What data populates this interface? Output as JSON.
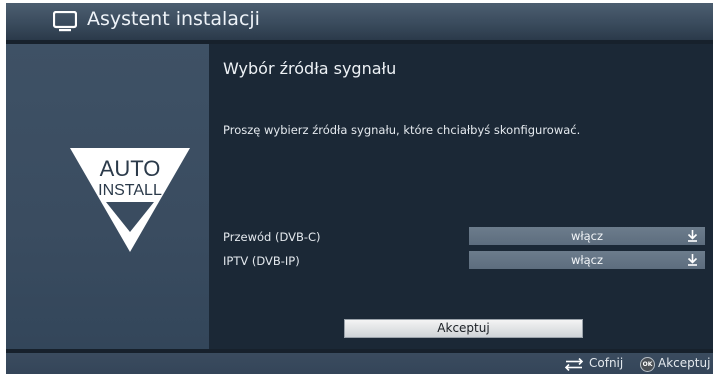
{
  "header": {
    "title": "Asystent instalacji",
    "icon": "tv-icon"
  },
  "logo": {
    "line1": "AUTO",
    "line2": "INSTALL"
  },
  "main": {
    "section_title": "Wybór źródła sygnału",
    "instruction": "Proszę wybierz źródła sygnału, które chciałbyś skonfigurować.",
    "settings": [
      {
        "label": "Przewód (DVB-C)",
        "value": "włącz"
      },
      {
        "label": "IPTV (DVB-IP)",
        "value": "włącz"
      }
    ],
    "accept_button": "Akceptuj"
  },
  "footer": {
    "back_label": "Cofnij",
    "ok_badge": "OK",
    "accept_label": "Akceptuj"
  },
  "colors": {
    "background": "#1d2a38",
    "header": "#3a4b5d",
    "left_panel": "#3a4c60",
    "right_panel": "#1b2836",
    "value_field": "#65758a",
    "button": "#e6e8ea",
    "text": "#e4e9ee"
  }
}
